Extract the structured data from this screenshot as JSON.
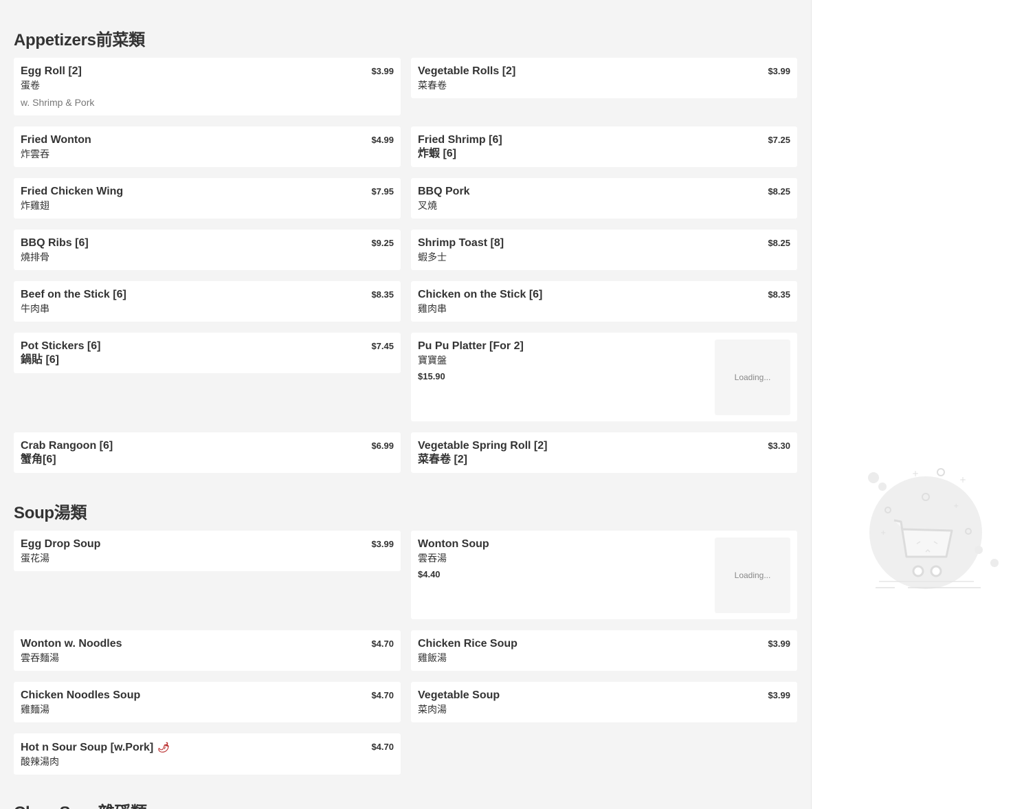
{
  "sections": {
    "appetizers": {
      "title": "Appetizers前菜類",
      "items": [
        {
          "name": "Egg Roll [2]",
          "cn": "蛋卷",
          "desc": "w. Shrimp & Pork",
          "price": "$3.99"
        },
        {
          "name": "Vegetable Rolls [2]",
          "cn": "菜春卷",
          "price": "$3.99"
        },
        {
          "name": "Fried Wonton",
          "cn": "炸雲吞",
          "price": "$4.99"
        },
        {
          "name": "Fried Shrimp [6]",
          "cn": "炸蝦 [6]",
          "price": "$7.25"
        },
        {
          "name": "Fried Chicken Wing",
          "cn": "炸雞翅",
          "price": "$7.95"
        },
        {
          "name": "BBQ Pork",
          "cn": "叉燒",
          "price": "$8.25"
        },
        {
          "name": "BBQ Ribs [6]",
          "cn": "燒排骨",
          "price": "$9.25"
        },
        {
          "name": "Shrimp Toast [8]",
          "cn": "蝦多士",
          "price": "$8.25"
        },
        {
          "name": "Beef on the Stick [6]",
          "cn": "牛肉串",
          "price": "$8.35"
        },
        {
          "name": "Chicken on the Stick [6]",
          "cn": "雞肉串",
          "price": "$8.35"
        },
        {
          "name": "Pot Stickers [6]",
          "cn": "鍋貼 [6]",
          "price": "$7.45"
        },
        {
          "name": "Pu Pu Platter [For 2]",
          "cn": "寶寶盤",
          "price": "$15.90",
          "image_status": "Loading..."
        },
        {
          "name": "Crab Rangoon [6]",
          "cn": "蟹角[6]",
          "price": "$6.99"
        },
        {
          "name": "Vegetable Spring Roll [2]",
          "cn": "菜春卷 [2]",
          "price": "$3.30"
        }
      ]
    },
    "soup": {
      "title": "Soup湯類",
      "items": [
        {
          "name": "Egg Drop Soup",
          "cn": "蛋花湯",
          "price": "$3.99"
        },
        {
          "name": "Wonton Soup",
          "cn": "雲吞湯",
          "price": "$4.40",
          "image_status": "Loading..."
        },
        {
          "name": "Wonton w. Noodles",
          "cn": "雲吞麵湯",
          "price": "$4.70"
        },
        {
          "name": "Chicken Rice Soup",
          "cn": "雞飯湯",
          "price": "$3.99"
        },
        {
          "name": "Chicken Noodles Soup",
          "cn": "雞麵湯",
          "price": "$4.70"
        },
        {
          "name": "Vegetable Soup",
          "cn": "菜肉湯",
          "price": "$3.99"
        },
        {
          "name": "Hot n Sour Soup [w.Pork]",
          "cn": "酸辣湯肉",
          "price": "$4.70",
          "spicy": true
        }
      ]
    },
    "chop_suey": {
      "title": "Chop Suey雜磎類"
    }
  },
  "colors": {
    "background": "#f4f4f4",
    "card": "#ffffff",
    "text": "#333333"
  }
}
